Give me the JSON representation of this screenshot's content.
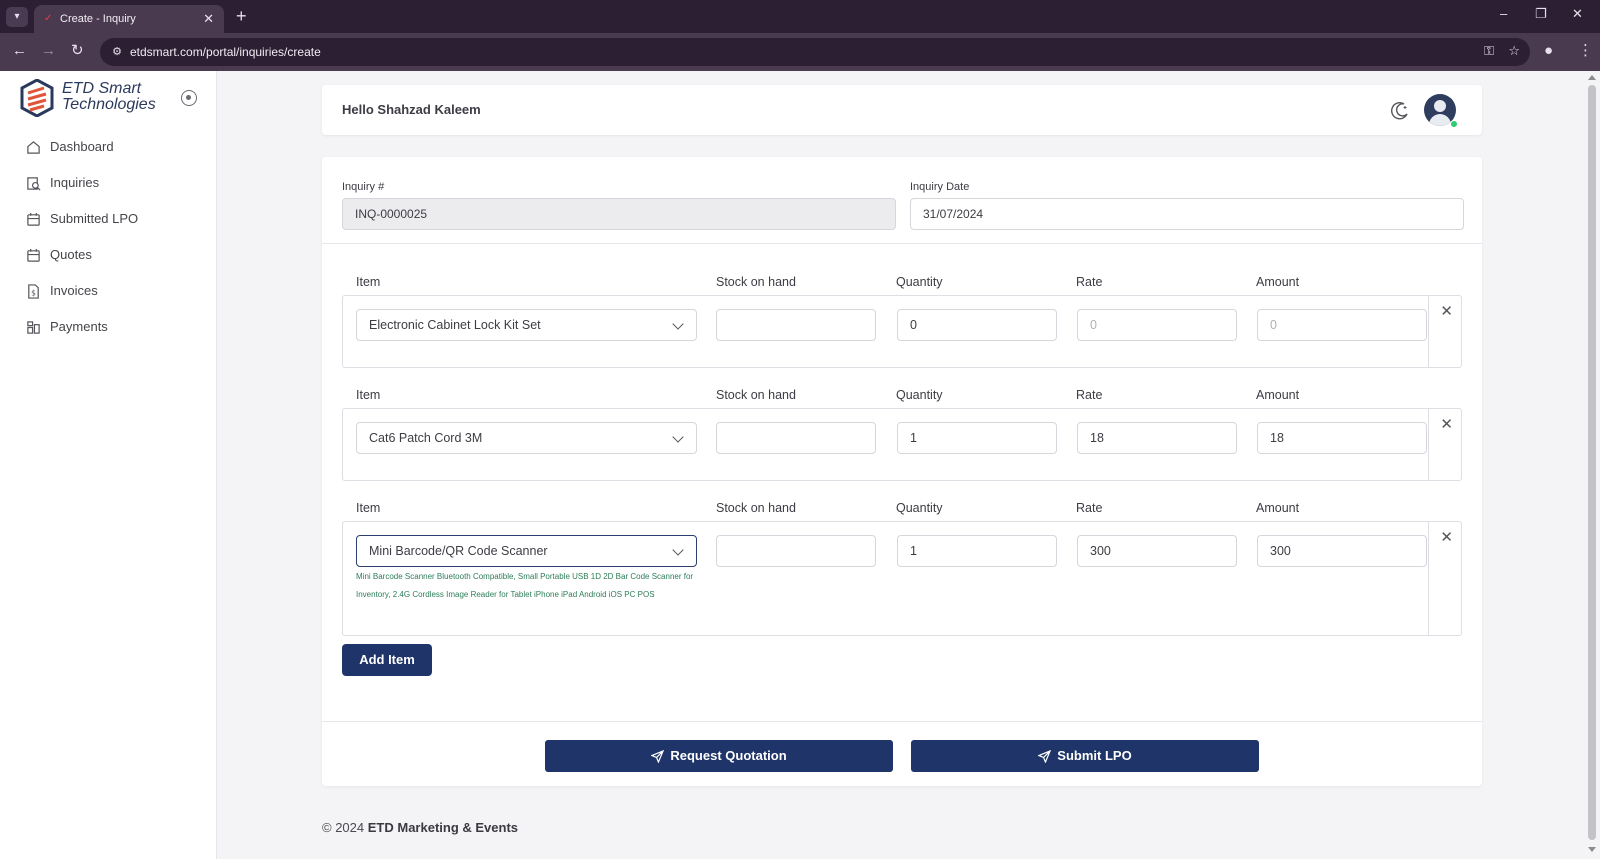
{
  "browser": {
    "tab_title": "Create - Inquiry",
    "tab_close": "✕",
    "new_tab": "+",
    "url": "etdsmart.com/portal/inquiries/create",
    "window": {
      "minimize": "–",
      "restore": "❐",
      "close": "✕"
    }
  },
  "sidebar": {
    "logo": {
      "line1": "ETD Smart",
      "line2": "Technologies"
    },
    "items": [
      {
        "label": "Dashboard",
        "icon": "home-icon"
      },
      {
        "label": "Inquiries",
        "icon": "inquiry-icon"
      },
      {
        "label": "Submitted LPO",
        "icon": "calendar-icon"
      },
      {
        "label": "Quotes",
        "icon": "calendar-icon"
      },
      {
        "label": "Invoices",
        "icon": "invoice-icon"
      },
      {
        "label": "Payments",
        "icon": "payments-icon"
      }
    ]
  },
  "header": {
    "greeting": "Hello Shahzad Kaleem"
  },
  "form": {
    "inquiry_no_label": "Inquiry #",
    "inquiry_no_value": "INQ-0000025",
    "inquiry_date_label": "Inquiry Date",
    "inquiry_date_value": "31/07/2024",
    "columns": {
      "item": "Item",
      "stock": "Stock on hand",
      "quantity": "Quantity",
      "rate": "Rate",
      "amount": "Amount"
    },
    "rows": [
      {
        "item": "Electronic Cabinet Lock Kit Set",
        "stock": "",
        "quantity": "0",
        "rate": "0",
        "amount": "0",
        "rate_placeholder": true,
        "description": ""
      },
      {
        "item": "Cat6 Patch Cord 3M",
        "stock": "",
        "quantity": "1",
        "rate": "18",
        "amount": "18",
        "rate_placeholder": false,
        "description": ""
      },
      {
        "item": "Mini Barcode/QR Code Scanner",
        "stock": "",
        "quantity": "1",
        "rate": "300",
        "amount": "300",
        "rate_placeholder": false,
        "description": "Mini Barcode Scanner Bluetooth Compatible, Small Portable USB 1D 2D Bar Code Scanner for Inventory, 2.4G Cordless Image Reader for Tablet iPhone iPad Android iOS PC POS"
      }
    ],
    "remove_icon": "✕",
    "add_item_label": "Add Item",
    "request_quotation_label": "Request Quotation",
    "submit_lpo_label": "Submit LPO"
  },
  "footer": {
    "prefix": "© 2024",
    "company": "ETD Marketing & Events"
  },
  "colors": {
    "primary": "#1f3468",
    "browser_dark": "#2d1f33",
    "browser_bar": "#4a3a50",
    "success_text": "#2e7d5a",
    "online_dot": "#2ecc71"
  }
}
